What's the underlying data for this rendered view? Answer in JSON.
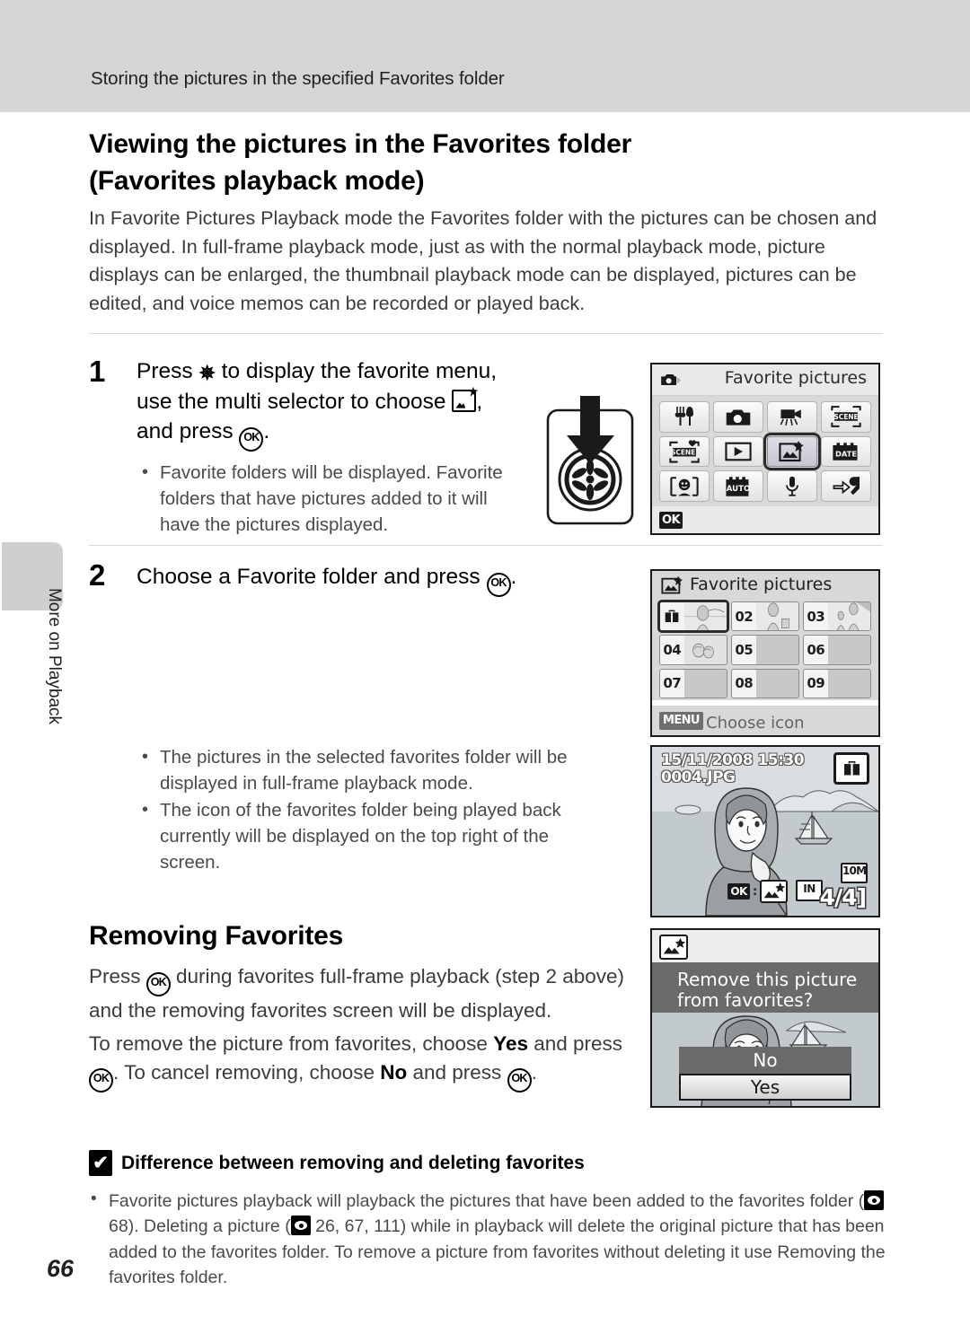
{
  "banner": {
    "running_head": "Storing the pictures in the specified Favorites folder"
  },
  "side_tab": {
    "label": "More on Playback"
  },
  "page": {
    "number": "66"
  },
  "title": "Viewing the pictures in the Favorites folder (Favorites playback mode)",
  "intro": "In Favorite Pictures Playback mode the Favorites folder with the pictures can be chosen and displayed. In full-frame playback mode, just as with the normal playback mode, picture displays can be enlarged, the thumbnail playback mode can be displayed, pictures can be edited, and voice memos can be recorded or played back.",
  "steps": [
    {
      "number": "1",
      "head_part1": "Press ",
      "head_part2": " to display the favorite menu, use the multi selector to choose ",
      "head_part3": ", and press ",
      "head_part4": ".",
      "bullets": [
        "Favorite folders will be displayed. Favorite folders that have pictures added to it will have the pictures displayed."
      ]
    },
    {
      "number": "2",
      "head_part1": "Choose a Favorite folder and press ",
      "head_part2": ".",
      "bullets": [
        "The pictures in the selected favorites folder will be displayed in full-frame playback mode.",
        "The icon of the favorites folder being played back currently will be displayed on the top right of the screen."
      ]
    }
  ],
  "section": {
    "heading": "Removing Favorites",
    "para1_a": "Press ",
    "para1_b": " during favorites full-frame playback (step 2 above) and the removing favorites screen will be displayed.",
    "para2_a": "To remove the picture from favorites, choose ",
    "para2_yes": "Yes",
    "para2_b": " and press ",
    "para2_c": ". To cancel removing,  choose ",
    "para2_no": "No",
    "para2_d": " and press ",
    "para2_e": "."
  },
  "note": {
    "mark": "✔",
    "heading": "Difference between removing and deleting favorites",
    "body_a": "Favorite pictures playback will playback the pictures that have been added to the favorites folder (",
    "body_ref1": " 68). Deleting a picture (",
    "body_ref2": " 26, 67, 111) while in playback will delete the original picture that has been added to the favorites folder. To remove a picture from favorites without deleting it use Removing the favorites folder."
  },
  "screens": {
    "menu": {
      "title": "Favorite pictures",
      "ok_label": "OK",
      "cells": [
        {
          "icon": "restaurant-icon",
          "glyph": "\u0001",
          "selected": false
        },
        {
          "icon": "camera-icon",
          "glyph": "",
          "selected": false
        },
        {
          "icon": "movie-icon",
          "glyph": "",
          "selected": false
        },
        {
          "icon": "scene-icon",
          "glyph": "SCENE",
          "selected": false
        },
        {
          "icon": "scene-heart-icon",
          "glyph": "SCENE",
          "selected": false
        },
        {
          "icon": "playback-icon",
          "glyph": "▶",
          "selected": false
        },
        {
          "icon": "favorite-pictures-icon",
          "glyph": "",
          "selected": true
        },
        {
          "icon": "date-icon",
          "glyph": "DATE",
          "selected": false
        },
        {
          "icon": "smile-icon",
          "glyph": "[··]",
          "selected": false
        },
        {
          "icon": "auto-icon",
          "glyph": "AUTO",
          "selected": false
        },
        {
          "icon": "microphone-icon",
          "glyph": "",
          "selected": false
        },
        {
          "icon": "setup-wrench-icon",
          "glyph": "",
          "selected": false
        }
      ]
    },
    "grid": {
      "title": "Favorite pictures",
      "menu_badge": "MENU",
      "foot_text": "Choose icon",
      "cells": [
        {
          "label": "",
          "icon": "briefcase-icon",
          "has_picture": true,
          "selected": true
        },
        {
          "label": "02",
          "icon": "",
          "has_picture": true,
          "selected": false
        },
        {
          "label": "03",
          "icon": "",
          "has_picture": true,
          "selected": false
        },
        {
          "label": "04",
          "icon": "",
          "has_picture": true,
          "selected": false
        },
        {
          "label": "05",
          "icon": "",
          "has_picture": false,
          "selected": false
        },
        {
          "label": "06",
          "icon": "",
          "has_picture": false,
          "selected": false
        },
        {
          "label": "07",
          "icon": "",
          "has_picture": false,
          "selected": false
        },
        {
          "label": "08",
          "icon": "",
          "has_picture": false,
          "selected": false
        },
        {
          "label": "09",
          "icon": "",
          "has_picture": false,
          "selected": false
        }
      ]
    },
    "full": {
      "date": "15/11/2008 15:30",
      "filename": "0004.JPG",
      "ok_label": "OK",
      "memory_label": "IN",
      "frame_count": "4/",
      "frame_total": "4]",
      "image_size": "10M"
    },
    "remove": {
      "message": "Remove this picture from favorites?",
      "no_label": "No",
      "yes_label": "Yes"
    }
  }
}
